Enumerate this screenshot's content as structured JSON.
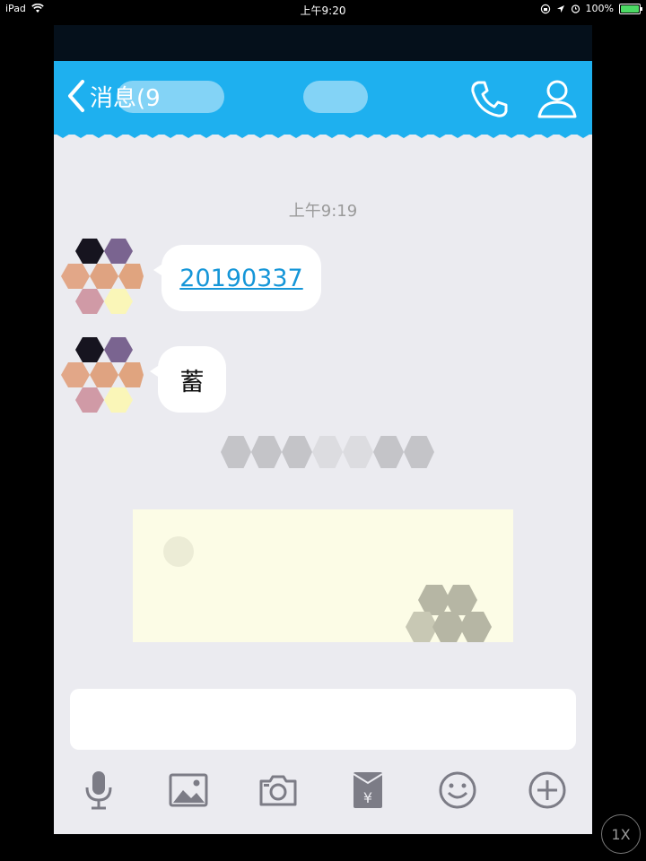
{
  "status_bar": {
    "device": "iPad",
    "time": "上午9:20",
    "battery_text": "100%",
    "battery_level": 1.0
  },
  "nav": {
    "back_label": "消息(9",
    "accent_color": "#1eb0ef"
  },
  "chat": {
    "timestamp": "上午9:19",
    "messages": [
      {
        "type": "link",
        "text": "20190337"
      },
      {
        "type": "text",
        "text": "蓄"
      }
    ]
  },
  "input": {
    "value": "",
    "placeholder": ""
  },
  "toolbar_icons": [
    "microphone-icon",
    "image-icon",
    "camera-icon",
    "red-packet-icon",
    "emoji-icon",
    "plus-icon"
  ],
  "toolbar": {
    "red_packet_symbol": "¥"
  },
  "zoom": {
    "label": "1X"
  }
}
